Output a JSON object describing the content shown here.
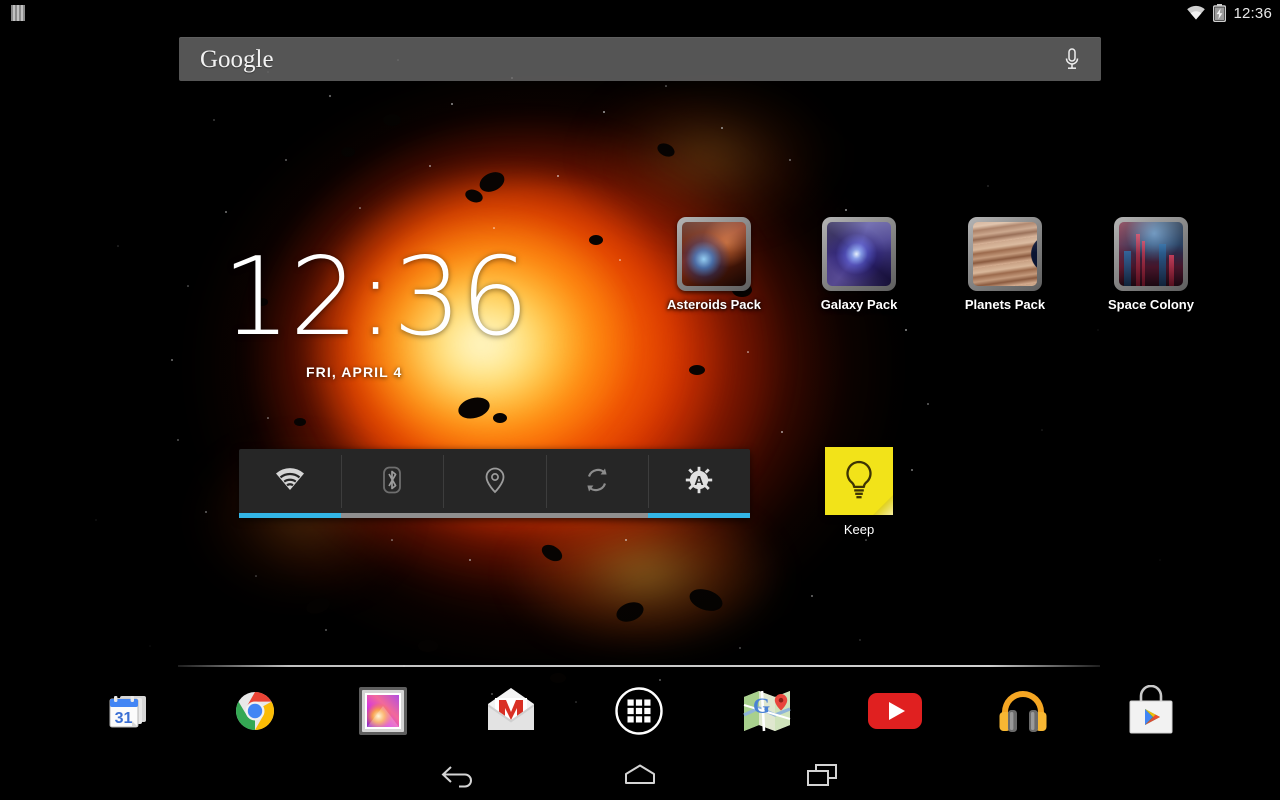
{
  "status_bar": {
    "notification_icon": "sim-card-icon",
    "wifi_icon": "wifi-icon",
    "battery_icon": "battery-charging-icon",
    "clock": "12:36"
  },
  "search": {
    "logo_text": "Google",
    "placeholder": "Google",
    "mic_icon": "microphone-icon"
  },
  "clock_widget": {
    "time": "12:36",
    "date": "FRI, APRIL 4"
  },
  "shortcuts": [
    {
      "label": "Asteroids Pack",
      "art": "asteroids-nebula-thumbnail"
    },
    {
      "label": "Galaxy Pack",
      "art": "spiral-galaxy-thumbnail"
    },
    {
      "label": "Planets Pack",
      "art": "gas-giant-planet-thumbnail"
    },
    {
      "label": "Space Colony",
      "art": "futuristic-city-thumbnail"
    }
  ],
  "power_widget": {
    "toggles": [
      {
        "name": "wifi",
        "icon": "wifi-icon",
        "state": "on"
      },
      {
        "name": "bluetooth",
        "icon": "bluetooth-icon",
        "state": "off"
      },
      {
        "name": "location",
        "icon": "location-pin-icon",
        "state": "off"
      },
      {
        "name": "sync",
        "icon": "sync-arrows-icon",
        "state": "off"
      },
      {
        "name": "brightness",
        "icon": "auto-brightness-icon",
        "state": "on"
      }
    ],
    "accent_on": "#33b5e5",
    "accent_off": "#8f8f8f",
    "background": "#262626"
  },
  "keep_widget": {
    "label": "Keep",
    "icon": "lightbulb-note-icon",
    "color": "#f2e319"
  },
  "dock": [
    {
      "label": "Calendar",
      "icon": "calendar-icon",
      "day": "31"
    },
    {
      "label": "Chrome",
      "icon": "chrome-icon"
    },
    {
      "label": "Gallery",
      "icon": "gallery-icon"
    },
    {
      "label": "Gmail",
      "icon": "gmail-icon"
    },
    {
      "label": "Apps",
      "icon": "all-apps-grid-icon"
    },
    {
      "label": "Maps",
      "icon": "maps-icon"
    },
    {
      "label": "YouTube",
      "icon": "youtube-icon"
    },
    {
      "label": "Play Music",
      "icon": "headphones-icon"
    },
    {
      "label": "Play Store",
      "icon": "play-store-bag-icon"
    }
  ],
  "nav_bar": [
    {
      "name": "back",
      "icon": "back-arrow-icon"
    },
    {
      "name": "home",
      "icon": "home-icon"
    },
    {
      "name": "recents",
      "icon": "recent-apps-icon"
    }
  ]
}
